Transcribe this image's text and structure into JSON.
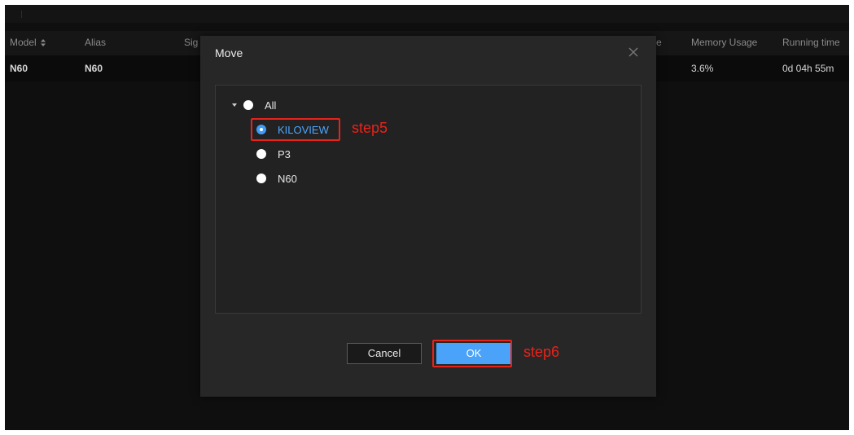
{
  "table": {
    "headers": {
      "model": "Model",
      "alias": "Alias",
      "signal": "Sig",
      "usage_partial": "e",
      "memory_usage": "Memory Usage",
      "running_time": "Running time"
    },
    "row": {
      "model": "N60",
      "alias": "N60",
      "memory_usage": "3.6%",
      "running_time": "0d 04h 55m"
    }
  },
  "dialog": {
    "title": "Move",
    "tree": [
      {
        "label": "All",
        "checked": false,
        "expanded": true
      },
      {
        "label": "KILOVIEW",
        "checked": true
      },
      {
        "label": "P3",
        "checked": false
      },
      {
        "label": "N60",
        "checked": false
      }
    ],
    "cancel_label": "Cancel",
    "ok_label": "OK"
  },
  "annotations": {
    "step5": "step5",
    "step6": "step6",
    "color": "#e8231b"
  },
  "colors": {
    "accent": "#4aa3f8",
    "selected_text": "#4ea6ff"
  },
  "icons": {
    "sort": "sort-icon",
    "close": "close-icon",
    "caret": "caret-down-icon"
  }
}
